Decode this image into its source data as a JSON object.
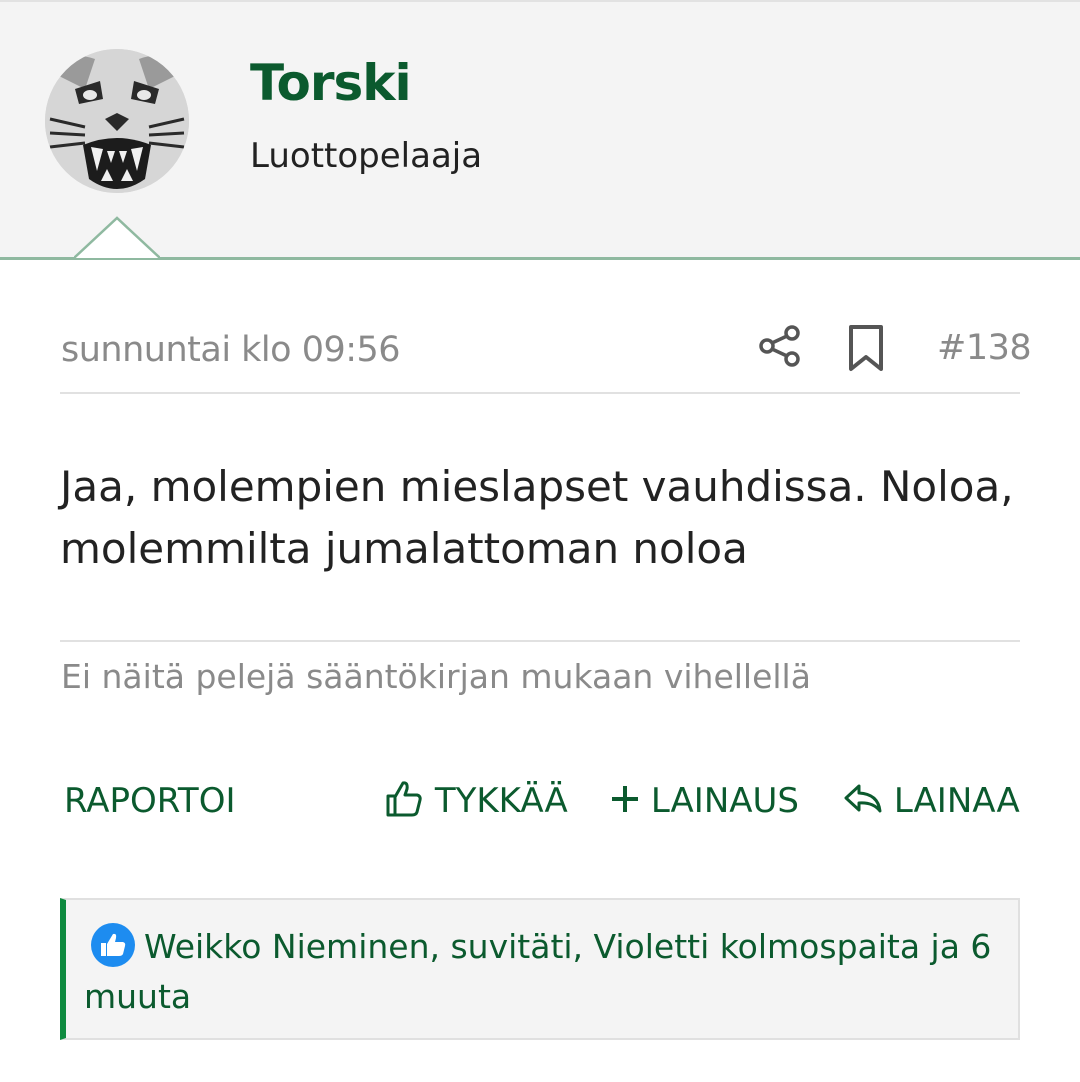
{
  "user": {
    "name": "Torski",
    "title": "Luottopelaaja"
  },
  "post": {
    "date": "sunnuntai klo 09:56",
    "number": "#138",
    "body": "Jaa, molempien mieslapset vauhdissa. Noloa, molemmilta jumalattoman noloa",
    "signature": "Ei näitä pelejä sääntökirjan mukaan vihellellä"
  },
  "actions": {
    "report": "RAPORTOI",
    "like": "TYKKÄÄ",
    "quote": "LAINAUS",
    "reply": "LAINAA"
  },
  "likes": {
    "text": "Weikko Nieminen, suvitäti, Violetti kolmospaita ja 6 muuta"
  },
  "colors": {
    "brand_green": "#0b5a2e",
    "accent_green": "#0e8a3f",
    "like_blue": "#1d8cf0",
    "muted_text": "#8a8a8a"
  },
  "icons": [
    "share-icon",
    "bookmark-icon",
    "thumbs-up-icon",
    "plus-icon",
    "reply-arrow-icon",
    "like-badge-icon"
  ]
}
